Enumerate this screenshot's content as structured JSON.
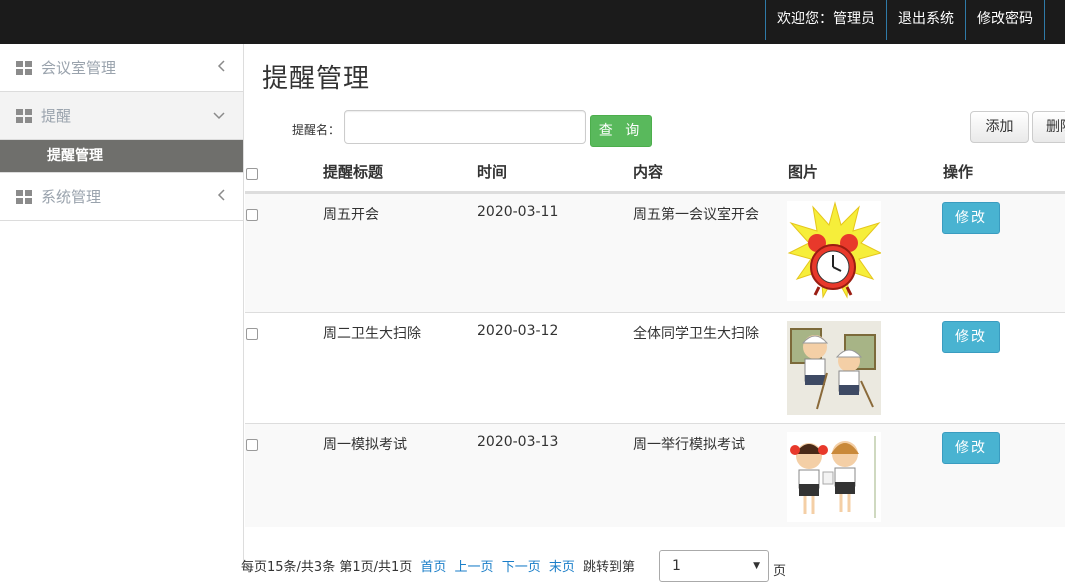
{
  "topnav": {
    "welcome": "欢迎您：管理员",
    "logout": "退出系统",
    "change_password": "修改密码"
  },
  "sidebar": {
    "items": [
      {
        "label": "会议室管理",
        "icon": "grid-icon",
        "chevron": "chevron-left-icon"
      },
      {
        "label": "提醒",
        "icon": "grid-icon",
        "chevron": "chevron-down-icon",
        "children": [
          {
            "label": "提醒管理"
          }
        ]
      },
      {
        "label": "系统管理",
        "icon": "grid-icon",
        "chevron": "chevron-left-icon"
      }
    ]
  },
  "main": {
    "title": "提醒管理",
    "search_label": "提醒名：",
    "search_value": "",
    "search_button": "查 询",
    "add_button": "添加",
    "delete_button": "删除"
  },
  "table": {
    "columns": [
      "提醒标题",
      "时间",
      "内容",
      "图片",
      "操作"
    ],
    "rows": [
      {
        "title": "周五开会",
        "time": "2020-03-11",
        "content": "周五第一会议室开会",
        "image": "alarm-clock-picture",
        "action": "修改"
      },
      {
        "title": "周二卫生大扫除",
        "time": "2020-03-12",
        "content": "全体同学卫生大扫除",
        "image": "cleaning-students-picture",
        "action": "修改"
      },
      {
        "title": "周一模拟考试",
        "time": "2020-03-13",
        "content": "周一举行模拟考试",
        "image": "exam-students-picture",
        "action": "修改"
      }
    ]
  },
  "pager": {
    "summary": "每页15条/共3条 第1页/共1页",
    "first": "首页",
    "prev": "上一页",
    "next": "下一页",
    "last": "末页",
    "jump_label": "跳转到第",
    "jump_value": "1",
    "unit": "页"
  },
  "colors": {
    "topbar": "#1b1b1b",
    "search_button": "#59b95c",
    "edit_button": "#49b3d1",
    "active_submenu": "#6f6f6c",
    "link": "#1a7ec8"
  }
}
